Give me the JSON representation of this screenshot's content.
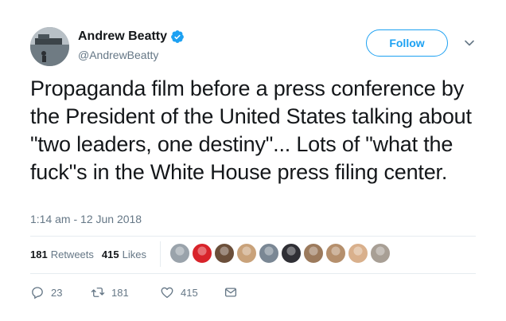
{
  "author": {
    "display_name": "Andrew Beatty",
    "handle": "@AndrewBeatty",
    "verified": true
  },
  "follow_button": {
    "label": "Follow"
  },
  "tweet": {
    "text": "Propaganda film before a press conference by the President of the United States talking about \"two leaders, one destiny\"... Lots of \"what the fuck\"s in the White House press filing center.",
    "timestamp": "1:14 am - 12 Jun 2018"
  },
  "stats": {
    "retweets_count": "181",
    "retweets_label": "Retweets",
    "likes_count": "415",
    "likes_label": "Likes"
  },
  "likers": [
    {
      "color": "#9aa3ab"
    },
    {
      "color": "#d8232a"
    },
    {
      "color": "#6b4f3a"
    },
    {
      "color": "#c9a27a"
    },
    {
      "color": "#7a8794"
    },
    {
      "color": "#2f2f35"
    },
    {
      "color": "#9c7a5c"
    },
    {
      "color": "#b58f6c"
    },
    {
      "color": "#d9b08c"
    },
    {
      "color": "#a89f95"
    }
  ],
  "actions": {
    "reply_count": "23",
    "retweet_count": "181",
    "like_count": "415"
  },
  "colors": {
    "accent": "#1da1f2",
    "text": "#14171a",
    "secondary": "#657786",
    "divider": "#e6ecf0"
  },
  "icons": {
    "verified": "verified-badge-icon",
    "caret": "chevron-down-icon",
    "reply": "reply-icon",
    "retweet": "retweet-icon",
    "like": "heart-icon",
    "dm": "envelope-icon"
  }
}
